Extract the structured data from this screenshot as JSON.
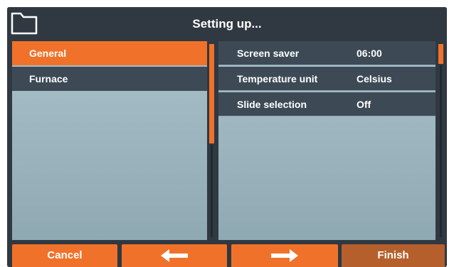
{
  "header": {
    "title": "Setting up...",
    "icon": "folder-icon"
  },
  "categories": [
    {
      "label": "General",
      "active": true
    },
    {
      "label": "Furnace",
      "active": false
    }
  ],
  "settings": [
    {
      "label": "Screen saver",
      "value": "06:00"
    },
    {
      "label": "Temperature unit",
      "value": "Celsius"
    },
    {
      "label": "Slide selection",
      "value": "Off"
    }
  ],
  "footer": {
    "cancel_label": "Cancel",
    "back_icon": "arrow-left-icon",
    "next_icon": "arrow-right-icon",
    "finish_label": "Finish"
  },
  "colors": {
    "accent": "#f0722a",
    "finish": "#b5602c",
    "frame": "#303841",
    "row": "#3d4a56",
    "panel": "#a9c0c8"
  }
}
